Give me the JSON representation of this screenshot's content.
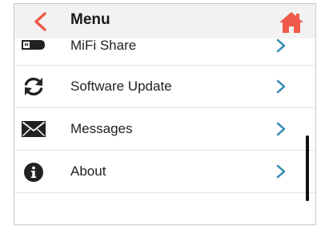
{
  "header": {
    "title": "Menu",
    "back_icon": "chevron-left-icon",
    "home_icon": "home-icon",
    "accent_color": "#ef5a4a"
  },
  "menu": {
    "items": [
      {
        "label": "MiFi Share",
        "icon": "usb-drive-icon"
      },
      {
        "label": "Software Update",
        "icon": "refresh-icon"
      },
      {
        "label": "Messages",
        "icon": "envelope-icon"
      },
      {
        "label": "About",
        "icon": "info-icon"
      }
    ],
    "chevron_color": "#3b8fb5"
  }
}
